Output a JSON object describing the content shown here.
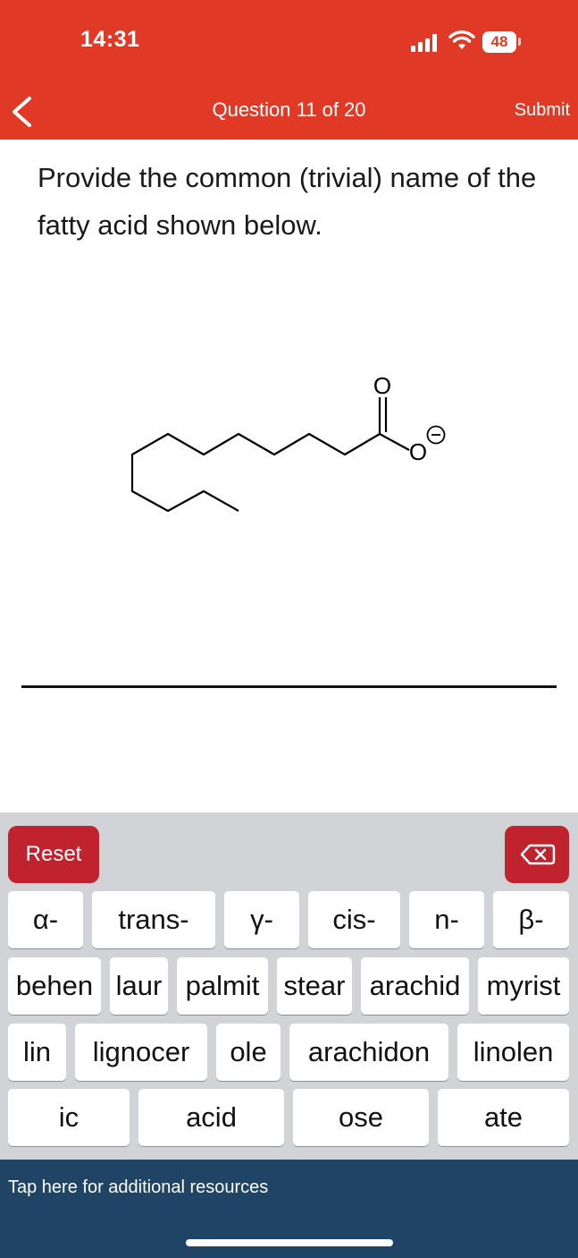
{
  "status": {
    "time": "14:31",
    "battery": "48"
  },
  "nav": {
    "title": "Question 11 of 20",
    "submit": "Submit"
  },
  "question": {
    "text": "Provide the common (trivial) name of the fatty acid shown below."
  },
  "molecule": {
    "oxygen": "O",
    "charge": "−"
  },
  "keyboard": {
    "reset": "Reset",
    "row1": [
      "α-",
      "trans-",
      "γ-",
      "cis-",
      "n-",
      "β-"
    ],
    "row2": [
      "behen",
      "laur",
      "palmit",
      "stear",
      "arachid",
      "myrist"
    ],
    "row3": [
      "lin",
      "lignocer",
      "ole",
      "arachidon",
      "linolen"
    ],
    "row4": [
      "ic",
      "acid",
      "ose",
      "ate"
    ]
  },
  "footer": {
    "resources": "Tap here for additional resources"
  },
  "colors": {
    "header": "#e03a26",
    "key_accent": "#c0232d",
    "footer": "#1f4466",
    "keyboard_bg": "#d1d3d7"
  }
}
